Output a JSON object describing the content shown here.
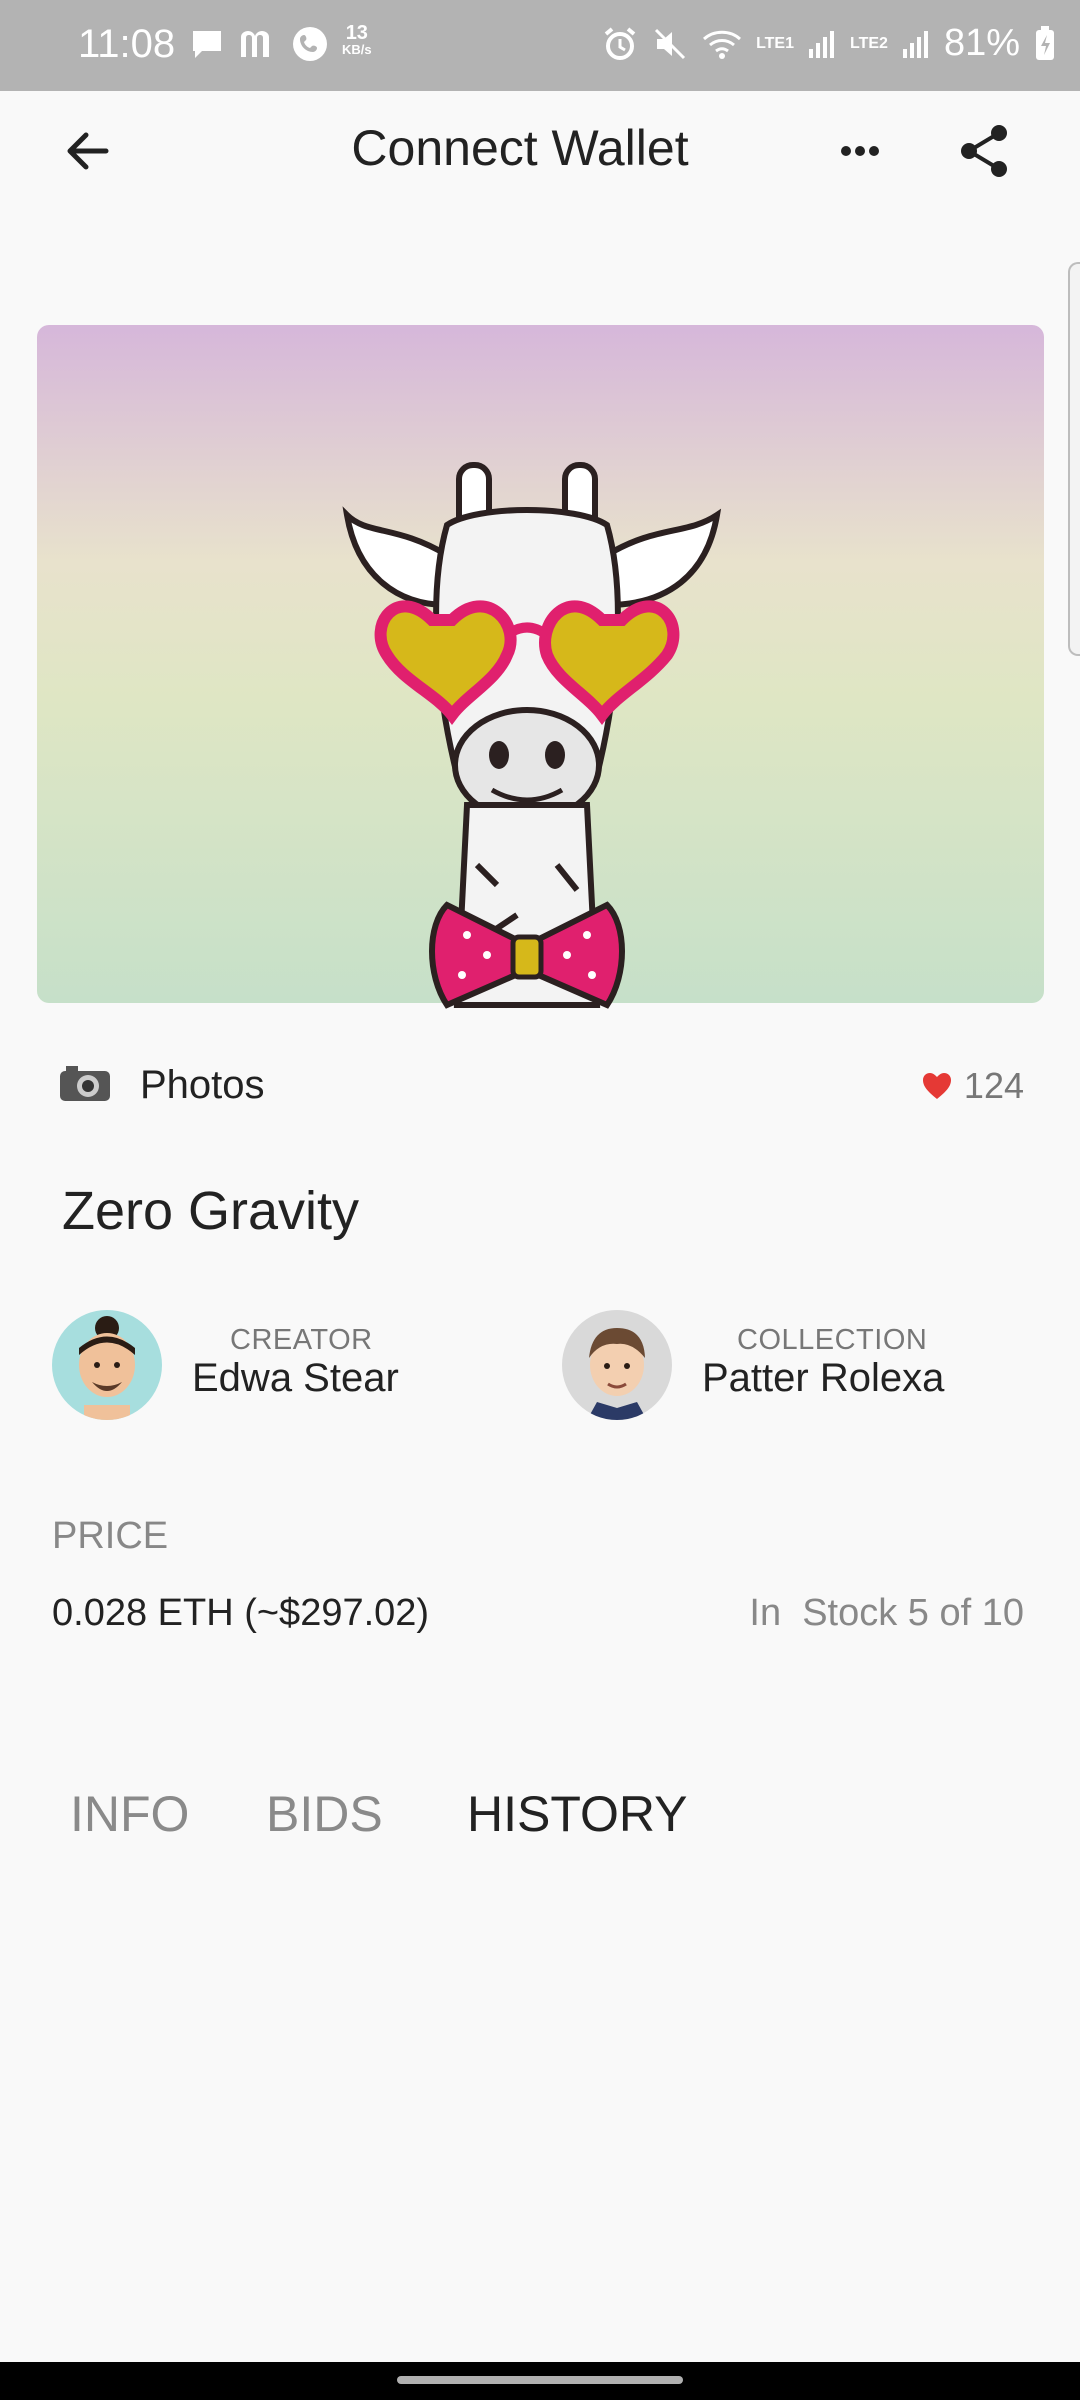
{
  "status_bar": {
    "time": "11:08",
    "net_speed_value": "13",
    "net_speed_unit": "KB/s",
    "sim1": "LTE1",
    "sim2": "LTE2",
    "battery": "81%"
  },
  "app_bar": {
    "title": "Connect Wallet"
  },
  "artwork": {
    "gradient_top": "#d6b7da",
    "gradient_bottom": "#c6e0c9"
  },
  "category": {
    "label": "Photos",
    "likes": "124",
    "like_color": "#e53935"
  },
  "item": {
    "title": "Zero Gravity"
  },
  "creator": {
    "label": "CREATOR",
    "name": "Edwa Stear"
  },
  "collection": {
    "label": "COLLECTION",
    "name": "Patter Rolexa"
  },
  "price": {
    "label": "PRICE",
    "value": "0.028 ETH (~$297.02)",
    "stock": "In  Stock 5 of 10"
  },
  "tabs": [
    {
      "label": "INFO",
      "active": false
    },
    {
      "label": "BIDS",
      "active": false
    },
    {
      "label": "HISTORY",
      "active": true
    }
  ]
}
